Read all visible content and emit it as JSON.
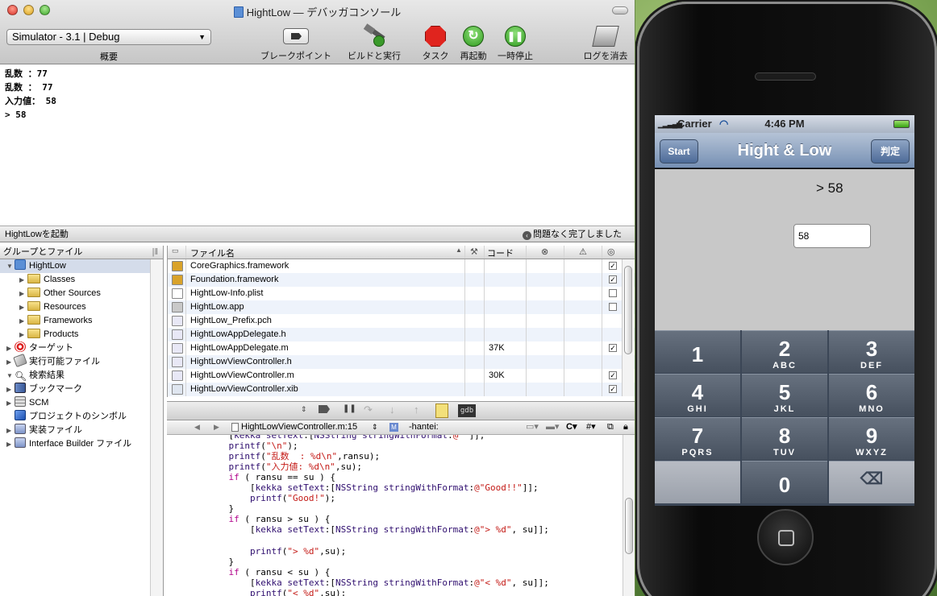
{
  "window": {
    "title": "HightLow — デバッガコンソール"
  },
  "toolbar": {
    "overview_value": "Simulator - 3.1 | Debug",
    "overview_label": "概要",
    "breakpoints_label": "ブレークポイント",
    "build_run_label": "ビルドと実行",
    "tasks_label": "タスク",
    "restart_label": "再起動",
    "pause_label": "一時停止",
    "clear_log_label": "ログを消去"
  },
  "console": {
    "lines": [
      "乱数  ：77",
      "乱数  ： 77",
      "入力値： 58",
      "> 58"
    ]
  },
  "status": {
    "left": "HightLowを起動",
    "right": "問題なく完了しました"
  },
  "sidebar": {
    "header": "グループとファイル",
    "items": [
      {
        "label": "HightLow"
      },
      {
        "label": "Classes"
      },
      {
        "label": "Other Sources"
      },
      {
        "label": "Resources"
      },
      {
        "label": "Frameworks"
      },
      {
        "label": "Products"
      },
      {
        "label": "ターゲット"
      },
      {
        "label": "実行可能ファイル"
      },
      {
        "label": "検索結果"
      },
      {
        "label": "ブックマーク"
      },
      {
        "label": "SCM"
      },
      {
        "label": "プロジェクトのシンボル"
      },
      {
        "label": "実装ファイル"
      },
      {
        "label": "Interface Builder ファイル"
      }
    ]
  },
  "files": {
    "col_name": "ファイル名",
    "col_code": "コード",
    "rows": [
      {
        "name": "CoreGraphics.framework",
        "code": "",
        "checked": true,
        "color": "#d9a32b"
      },
      {
        "name": "Foundation.framework",
        "code": "",
        "checked": true,
        "color": "#d9a32b"
      },
      {
        "name": "HightLow-Info.plist",
        "code": "",
        "checked": false,
        "color": "#ffffff"
      },
      {
        "name": "HightLow.app",
        "code": "",
        "checked": false,
        "color": "#c9c9c9"
      },
      {
        "name": "HightLow_Prefix.pch",
        "code": "",
        "checked": null,
        "color": "#e8e8f6"
      },
      {
        "name": "HightLowAppDelegate.h",
        "code": "",
        "checked": null,
        "color": "#e8e8f6"
      },
      {
        "name": "HightLowAppDelegate.m",
        "code": "37K",
        "checked": true,
        "color": "#e8e8f6"
      },
      {
        "name": "HightLowViewController.h",
        "code": "",
        "checked": null,
        "color": "#e8e8f6"
      },
      {
        "name": "HightLowViewController.m",
        "code": "30K",
        "checked": true,
        "color": "#e8e8f6"
      },
      {
        "name": "HightLowViewController.xib",
        "code": "",
        "checked": true,
        "color": "#dfe6f0"
      }
    ]
  },
  "editor": {
    "file": "HightLowViewController.m:15",
    "symbol": "-hantei:",
    "lines": [
      "    [kekka setText:[NSString stringWithFormat:@\"\"]];",
      "    printf(\"\\n\");",
      "    printf(\"乱数  : %d\\n\",ransu);",
      "    printf(\"入力値: %d\\n\",su);",
      "    if ( ransu == su ) {",
      "        [kekka setText:[NSString stringWithFormat:@\"Good!!\"]];",
      "        printf(\"Good!\");",
      "    }",
      "    if ( ransu > su ) {",
      "        [kekka setText:[NSString stringWithFormat:@\"> %d\", su]];",
      "",
      "        printf(\"> %d\",su);",
      "    }",
      "    if ( ransu < su ) {",
      "        [kekka setText:[NSString stringWithFormat:@\"< %d\", su]];",
      "        printf(\"< %d\",su);"
    ]
  },
  "phone": {
    "carrier": "Carrier",
    "time": "4:46 PM",
    "nav_title": "Hight & Low",
    "start_label": "Start",
    "judge_label": "判定",
    "result": "> 58",
    "input_value": "58",
    "keys": [
      {
        "n": "1",
        "l": ""
      },
      {
        "n": "2",
        "l": "ABC"
      },
      {
        "n": "3",
        "l": "DEF"
      },
      {
        "n": "4",
        "l": "GHI"
      },
      {
        "n": "5",
        "l": "JKL"
      },
      {
        "n": "6",
        "l": "MNO"
      },
      {
        "n": "7",
        "l": "PQRS"
      },
      {
        "n": "8",
        "l": "TUV"
      },
      {
        "n": "9",
        "l": "WXYZ"
      },
      {
        "n": "",
        "l": ""
      },
      {
        "n": "0",
        "l": ""
      },
      {
        "n": "",
        "l": ""
      }
    ]
  }
}
